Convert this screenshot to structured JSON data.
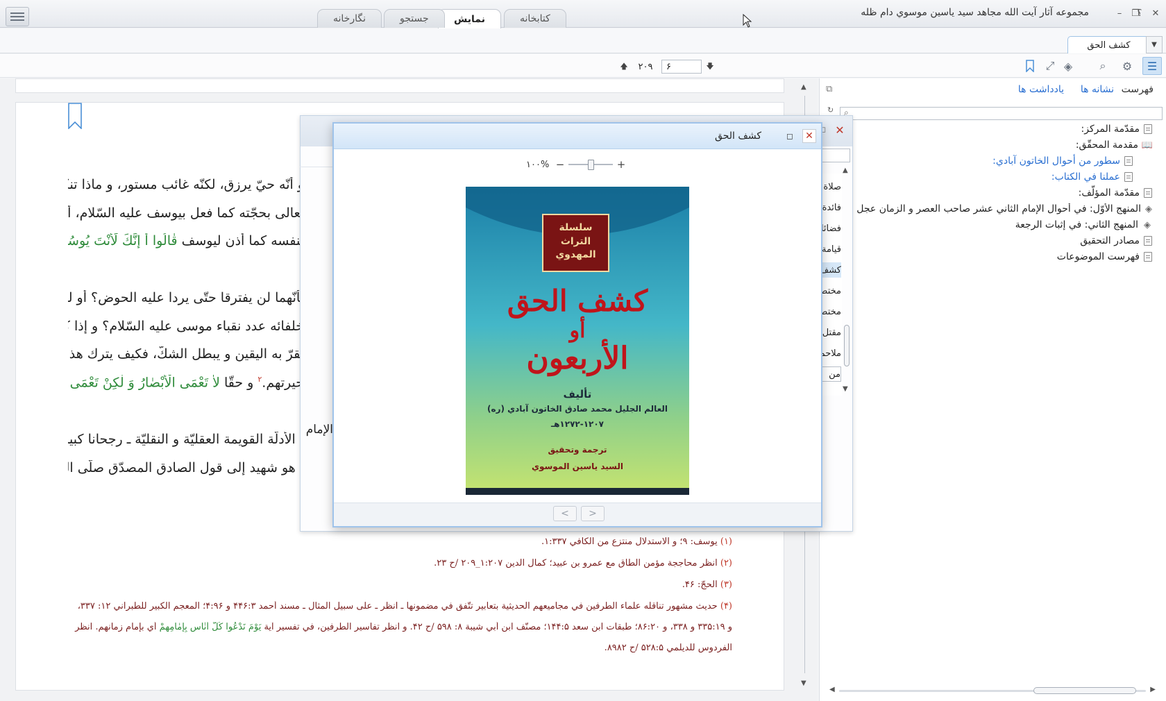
{
  "window": {
    "title": "مجموعه آثار آیت الله مجاهد سید یاسین موسوي دام ظله",
    "help_label": "؟",
    "minimize_label": "–",
    "restore_label": "❐",
    "close_label": "✕"
  },
  "top_tabs": [
    {
      "label": "کتابخانه"
    },
    {
      "label": "نمایش"
    },
    {
      "label": "جستجو"
    },
    {
      "label": "نگارخانه"
    }
  ],
  "book_tab": {
    "label": "کشف الحق"
  },
  "toolbar": {
    "page_current": "۶",
    "page_total": "۲۰۹"
  },
  "sidebar": {
    "tabs": [
      {
        "label": "فهرست"
      },
      {
        "label": "نشانه ها"
      },
      {
        "label": "يادداشت ها"
      }
    ],
    "toc": [
      {
        "label": "مقدّمة المركز:"
      },
      {
        "label": "مقدمة المحقّق:"
      },
      {
        "label": "سطور من أحوال الخاتون آبادي:"
      },
      {
        "label": "عملنا في الكتاب:"
      },
      {
        "label": "مقدّمة المؤلّف:"
      },
      {
        "label": "المنهج الأوّل: في أحوال الإمام الثاني عشر صاحب العصر و الزمان عجل اللّه تعالى"
      },
      {
        "label": "المنهج الثاني: في إثبات الرجعة"
      },
      {
        "label": "مصادر التحقيق"
      },
      {
        "label": "فهرست الموضوعات"
      }
    ]
  },
  "document": {
    "lines": [
      {
        "text": "و أنّه حيّ يرزق، لكنّه غائب مستور، و ماذا تنكر"
      },
      {
        "text": "تعالى بحجّته كما فعل بيوسف عليه السّلام، أن"
      },
      {
        "text_a": "بنفسه كما أذن ليوسف ",
        "quran": "قٰالُوا أَ إِنَّكَ لَأَنْتَ يُوسُفُ"
      },
      {
        "text": "بأنّهما لن يفترقا حتّى يردا عليه الحوض؟ أو لم"
      },
      {
        "text": "خلفائه عدد نقباء موسى عليه السّلام؟ و إذا كان"
      },
      {
        "text": "يقرّ به اليقين و يبطل الشكّ، فكيف يترك هذا"
      },
      {
        "text_a": "حيرتهم.",
        "sup": "۲",
        "text_b": " و حقّا ",
        "quran": "لاٰ تَعْمَى الْأَبْصٰارُ وَ لٰكِنْ تَعْمَى"
      },
      {
        "text": "، الأدلّة القويمة العقليّة و النقليّة ـ رجحانا كبيرا"
      },
      {
        "text": "، هو شهيد إلى قول الصادق المصدّق صلّى اللّه"
      }
    ],
    "margin_word": "الإمام",
    "footnotes": [
      {
        "num": "(۱)",
        "text": "يوسف: ۹؛ و الاستدلال منتزع من الكافي ۱:۳۳۷."
      },
      {
        "num": "(۲)",
        "text": "انظر محاججة مؤمن الطاق مع عمرو بن عبيد؛ كمال الدين ۱:۲۰۷_۲۰۹ /ح ۲۳."
      },
      {
        "num": "(۳)",
        "text": "الحجّ: ۴۶."
      },
      {
        "num": "(۴)",
        "text": "حديث مشهور تناقله علماء الطرفين في مجاميعهم الحديثية بتعابير تتّفق في مضمونها ـ انظر ـ على سبيل المثال ـ مسند أحمد ۴۴۶:۳ و ۴:۹۶؛ المعجم الكبير للطبراني ۱۲: ۳۳۷،"
      },
      {
        "num": "",
        "text_a": "و ۳۳۵:۱۹ و ۳۳۸، و ۸۶:۲۰؛ طبقات ابن سعد ۱۴۴:۵؛ مصنّف ابن أبي شيبة ۸: ۵۹۸ /ح ۴۲. و انظر تفاسير الطرفين، في تفسير آية ",
        "quran": "يَوْمَ نَدْعُوا كُلَّ أُنٰاسٍ بِإِمٰامِهِمْ",
        "text_b": " أي بإمام زمانهم. انظر"
      },
      {
        "num": "",
        "text": "الفردوس للديلمي ۵۲۸:۵ /ح ۸۹۸۲."
      }
    ]
  },
  "bg_dialog": {
    "items": [
      {
        "label": "صلاة"
      },
      {
        "label": "فائدة"
      },
      {
        "label": "فضائل"
      },
      {
        "label": "قيامة"
      },
      {
        "label": "كشف"
      },
      {
        "label": "مختصر"
      },
      {
        "label": "مختصر"
      },
      {
        "label": "مقتل"
      },
      {
        "label": "ملاحم"
      },
      {
        "label": "من"
      }
    ]
  },
  "dialog": {
    "title": "کشف الحق",
    "zoom_label": "۱۰۰%",
    "zoom_level": 0.5,
    "cover": {
      "series": "سلسلة التراث المهدوي",
      "title_1": "كشف الحق",
      "title_2": "أو",
      "title_3": "الأربعون",
      "author_label": "تأليف",
      "author": "العالم الجليل محمد صادق الخاتون آبادي (ره)",
      "dates": "۱۲۷۲-۱۲۰۷هـ",
      "translator_label": "ترجمة وتحقيق",
      "translator": "السيد ياسين الموسوي"
    }
  },
  "colors": {
    "accent": "#2e6fb3",
    "quran_text": "#2e8b3a",
    "footnote_text": "#7a1f1f",
    "close_red": "#c0392b",
    "link_blue": "#2a6fd1"
  }
}
